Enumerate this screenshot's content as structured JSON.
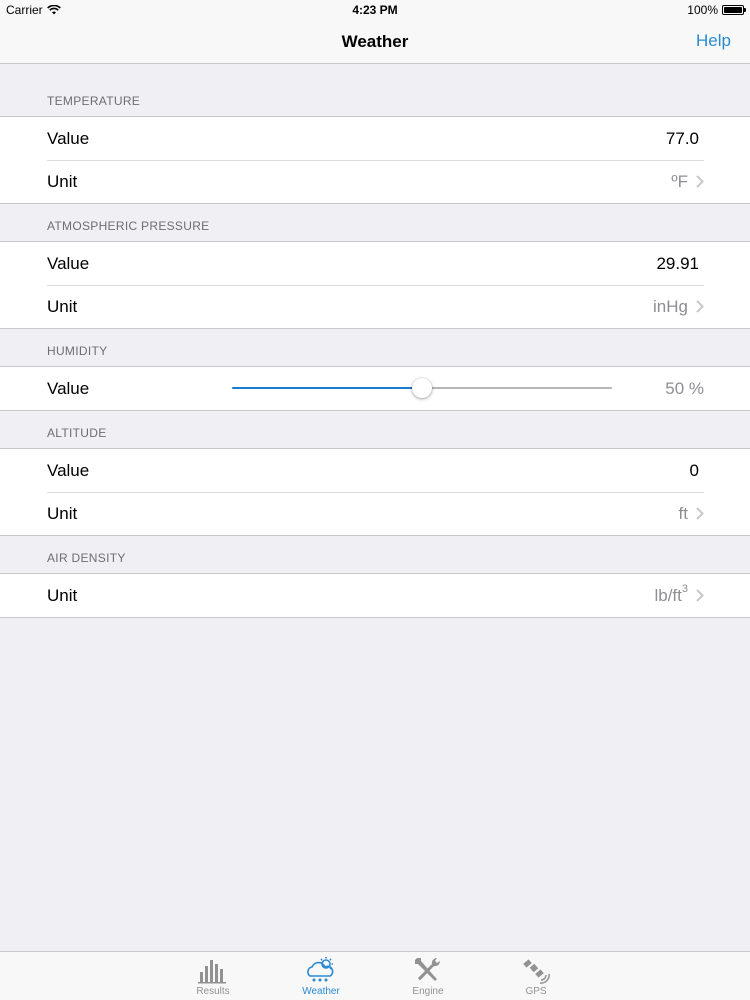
{
  "status": {
    "carrier": "Carrier",
    "time": "4:23 PM",
    "battery": "100%"
  },
  "nav": {
    "title": "Weather",
    "help": "Help"
  },
  "sections": {
    "temperature": {
      "header": "TEMPERATURE",
      "value_label": "Value",
      "value": "77.0",
      "unit_label": "Unit",
      "unit": "ºF"
    },
    "pressure": {
      "header": "ATMOSPHERIC PRESSURE",
      "value_label": "Value",
      "value": "29.91",
      "unit_label": "Unit",
      "unit": "inHg"
    },
    "humidity": {
      "header": "HUMIDITY",
      "value_label": "Value",
      "percent_text": "50 %",
      "percent": 50
    },
    "altitude": {
      "header": "ALTITUDE",
      "value_label": "Value",
      "value": "0",
      "unit_label": "Unit",
      "unit": "ft"
    },
    "density": {
      "header": "AIR DENSITY",
      "unit_label": "Unit",
      "unit": "lb/ft",
      "unit_exp": "3"
    }
  },
  "tabs": [
    {
      "label": "Results",
      "icon": "bar-chart-icon"
    },
    {
      "label": "Weather",
      "icon": "weather-cloud-icon",
      "active": true
    },
    {
      "label": "Engine",
      "icon": "tools-icon"
    },
    {
      "label": "GPS",
      "icon": "satellite-icon"
    }
  ],
  "colors": {
    "accent": "#2a8ad1",
    "slider_fill": "#1a7bd2"
  }
}
